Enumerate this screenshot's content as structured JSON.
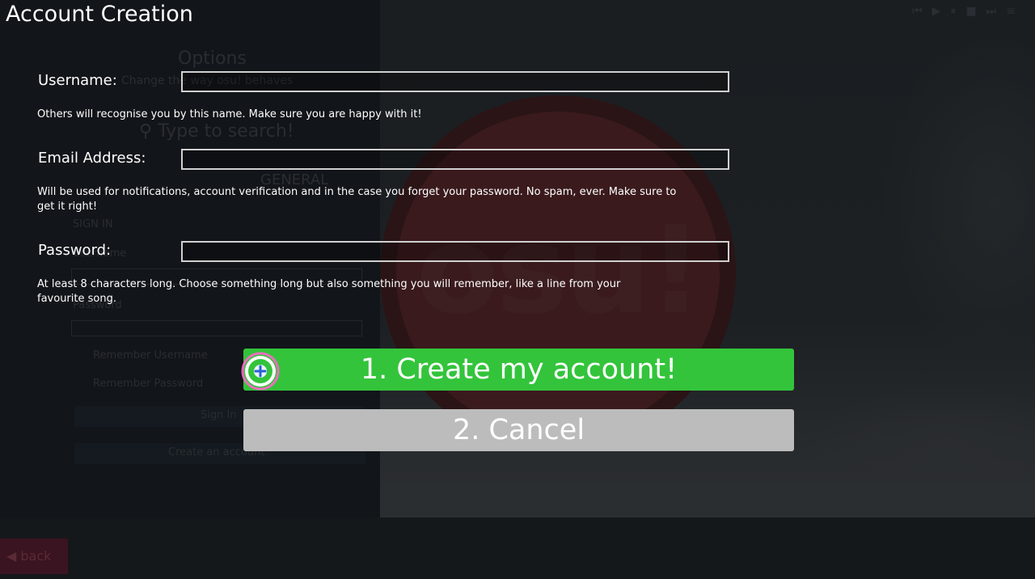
{
  "dialog": {
    "title": "Account Creation"
  },
  "fields": {
    "username": {
      "label": "Username:",
      "value": "",
      "hint": "Others will recognise you by this name. Make sure you are happy with it!"
    },
    "email": {
      "label": "Email Address:",
      "value": "",
      "hint": "Will be used for notifications, account verification and in the case you forget your password. No spam, ever. Make sure to get it right!"
    },
    "password": {
      "label": "Password:",
      "value": "",
      "hint": "At least 8 characters long. Choose something long but also something you will remember, like a line from your favourite song."
    }
  },
  "buttons": {
    "create": "1. Create my account!",
    "cancel": "2. Cancel"
  },
  "background": {
    "options_title": "Options",
    "options_subtitle": "Change the way osu! behaves",
    "search_placeholder": "Type to search!",
    "section": "GENERAL",
    "signin_header": "SIGN IN",
    "username_label": "Username",
    "password_label": "Password",
    "remember_username": "Remember Username",
    "remember_password": "Remember Password",
    "signin_button": "Sign In",
    "create_account_button": "Create an account",
    "logo": "osu!",
    "back": "back"
  },
  "colors": {
    "create_button": "#33c43b",
    "cancel_button": "#bcbcbc",
    "cursor_ring": "#ff66cc",
    "cursor_core": "#33c43b"
  }
}
